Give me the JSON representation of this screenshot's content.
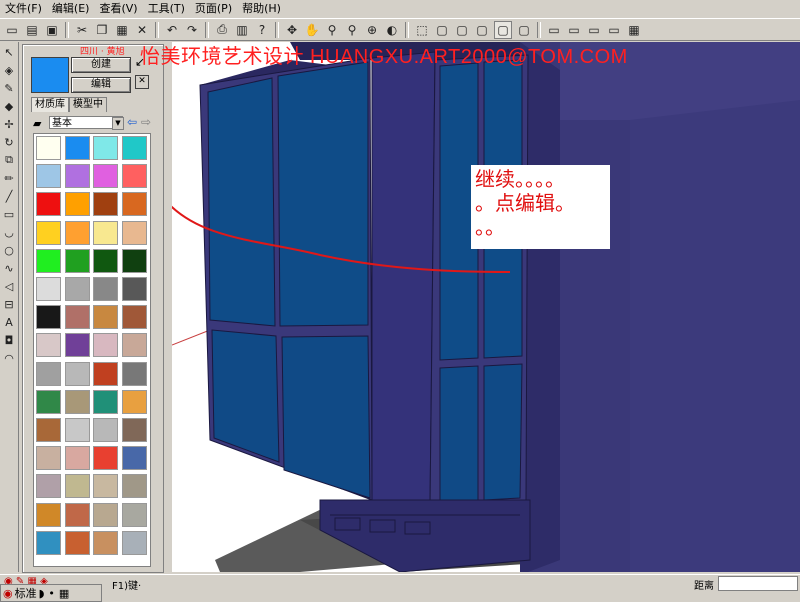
{
  "menu": [
    "文件(F)",
    "编辑(E)",
    "查看(V)",
    "工具(T)",
    "页面(P)",
    "帮助(H)"
  ],
  "watermark": "怡美环境艺术设计 HUANGXU.ART2000@TOM.COM",
  "watermark_small": "四川 · 黄旭",
  "material": {
    "create_button": "创建",
    "edit_button": "编辑",
    "tab_library": "材质库",
    "tab_in_model": "模型中",
    "library_select": "基本",
    "current_color": "#1a8cf0"
  },
  "annotation": {
    "line1": "继续。。。。",
    "line2": "。点编辑。",
    "line3": "。。"
  },
  "status": {
    "distance_label": "距离",
    "hint": "F1)键·",
    "lang": "标准"
  },
  "swatches": [
    "#fffff0",
    "#1a8cf0",
    "#7fe8e8",
    "#20c8c8",
    "#9ec6e6",
    "#b070e0",
    "#e060e0",
    "#ff6060",
    "#ee1010",
    "#ffa000",
    "#a04010",
    "#d86820",
    "#ffd020",
    "#ffa030",
    "#f8e890",
    "#e8b890",
    "#20ee20",
    "#20a020",
    "#105810",
    "#104010",
    "#dcdcdc",
    "#a8a8a8",
    "#888888",
    "#585858",
    "#181818",
    "#b07068",
    "#c88840",
    "#a05838",
    "#d8c8c8",
    "#704098",
    "#d8b8c0",
    "#c8a898",
    "#a0a0a0",
    "#b8b8b8",
    "#c04020",
    "#787878",
    "#308848",
    "#a89878",
    "#209078",
    "#e8a040",
    "#a86838",
    "#c8c8c8",
    "#b8b8b8",
    "#806858",
    "#c8b0a0",
    "#d8a8a0",
    "#e84030",
    "#4868a8",
    "#b0a0a8",
    "#c0b890",
    "#c8b8a0",
    "#a09888",
    "#d08828",
    "#c06848",
    "#b8a890",
    "#a8a8a0",
    "#3090c0",
    "#c86030",
    "#c89060",
    "#a8b0b8"
  ]
}
